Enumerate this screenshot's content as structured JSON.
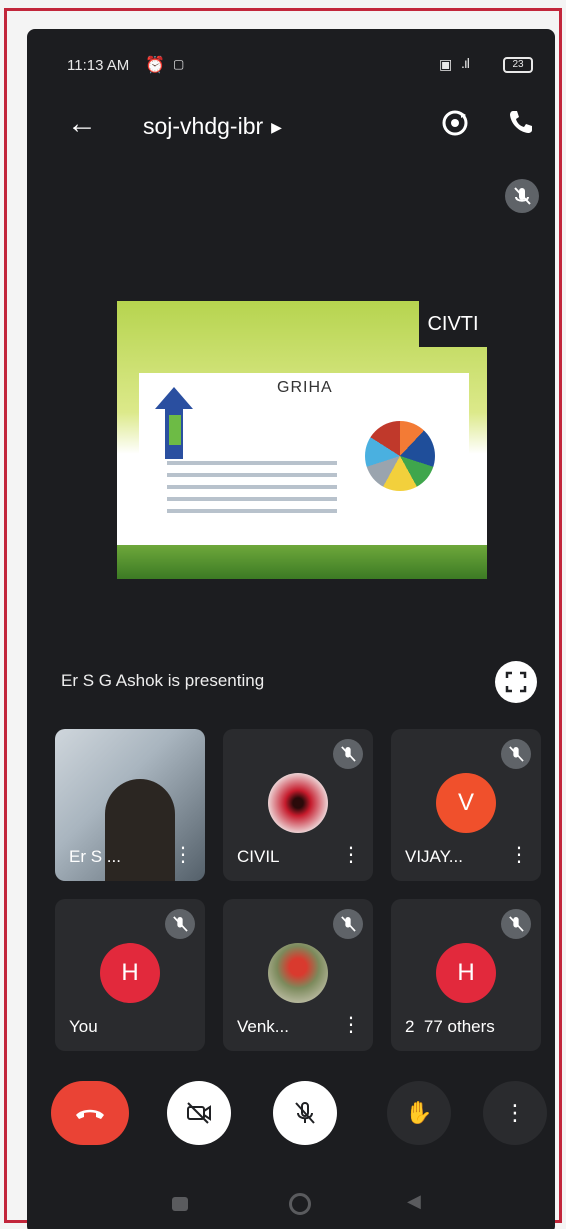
{
  "status_bar": {
    "time": "11:13 AM",
    "alarm_icon": "alarm-icon",
    "battery": "23"
  },
  "header": {
    "meeting_code": "soj-vhdg-ibr",
    "back_icon": "arrow-left-icon",
    "switch_camera_icon": "switch-camera-icon",
    "audio_icon": "phone-audio-icon"
  },
  "slide": {
    "title": "GRIHA",
    "logo_text": "CIVTI"
  },
  "presenting_text": "Er S G Ashok is presenting",
  "participants": [
    {
      "name": "Er S ...",
      "type": "video",
      "muted": false
    },
    {
      "name": "CIVIL",
      "type": "photo",
      "muted": true,
      "avatar_color": "#c51b2c"
    },
    {
      "name": "VIJAY...",
      "type": "letter",
      "letter": "V",
      "muted": true,
      "avatar_color": "#f0502c"
    },
    {
      "name": "You",
      "type": "letter",
      "letter": "H",
      "muted": true,
      "avatar_color": "#e2293c"
    },
    {
      "name": "Venk...",
      "type": "photo",
      "muted": true,
      "avatar_color": "#6b7a52"
    },
    {
      "name": "77 others",
      "prefix": "2",
      "type": "letter",
      "letter": "H",
      "muted": true,
      "avatar_color": "#e2293c"
    }
  ],
  "colors": {
    "background": "#1c1d20",
    "tile": "#2a2b2e",
    "end_call": "#ea4335"
  }
}
